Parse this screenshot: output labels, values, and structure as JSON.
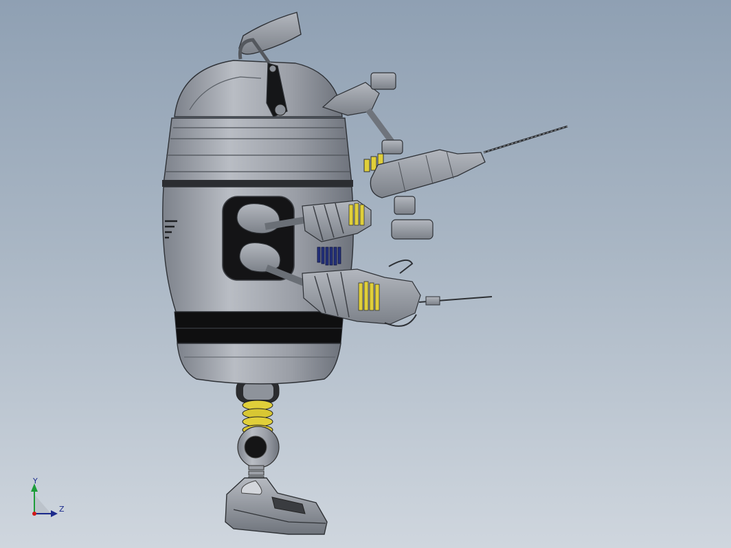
{
  "viewport": {
    "background_top": "#8fa0b3",
    "background_bottom": "#cfd6de"
  },
  "model": {
    "body_color": "#9a9ea6",
    "dark_band_color": "#0f0f10",
    "spring_color": "#e0cf3a",
    "vent_color": "#23307a"
  },
  "triad": {
    "y_label": "Y",
    "z_label": "Z",
    "y_axis_color": "#1e9d3a",
    "z_axis_color": "#1b2a8c",
    "origin_color": "#d01818"
  }
}
